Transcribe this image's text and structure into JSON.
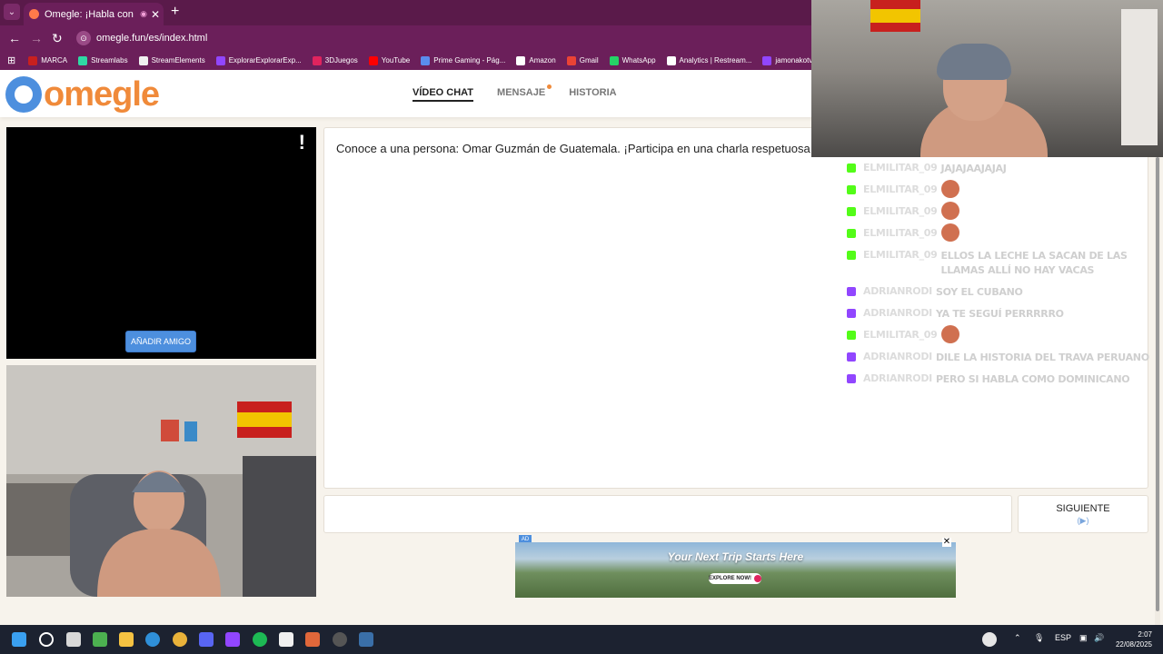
{
  "browser": {
    "tab_title": "Omegle: ¡Habla con Descon",
    "tab_audio_dot": "◉",
    "tab_close": "✕",
    "new_tab": "+",
    "url": "omegle.fun/es/index.html",
    "bookmarks": [
      {
        "label": "MARCA",
        "color": "#c8201e"
      },
      {
        "label": "Streamlabs",
        "color": "#2fd8a4"
      },
      {
        "label": "StreamElements",
        "color": "#f0f0f0"
      },
      {
        "label": "ExplorarExplorarExp...",
        "color": "#9146ff"
      },
      {
        "label": "3DJuegos",
        "color": "#e0245e"
      },
      {
        "label": "YouTube",
        "color": "#ff0000"
      },
      {
        "label": "Prime Gaming - Pág...",
        "color": "#5a8dee"
      },
      {
        "label": "Amazon",
        "color": "#ffffff"
      },
      {
        "label": "Gmail",
        "color": "#ea4335"
      },
      {
        "label": "WhatsApp",
        "color": "#25d366"
      },
      {
        "label": "Analytics | Restream...",
        "color": "#ffffff"
      },
      {
        "label": "jamonakotv - T",
        "color": "#9146ff"
      }
    ]
  },
  "site": {
    "logo": "omegle",
    "nav": [
      "VÍDEO CHAT",
      "MENSAJE",
      "HISTORIA"
    ]
  },
  "video": {
    "report": "!",
    "add_friend": "AÑADIR AMIGO"
  },
  "chat": {
    "intro": "Conoce a una persona: Omar Guzmán de Guatemala. ¡Participa en una charla respetuosa"
  },
  "next_button": {
    "label": "SIGUIENTE",
    "sub": "(▶)"
  },
  "ad": {
    "tag": "AD",
    "close": "✕",
    "headline": "Your Next Trip Starts Here",
    "cta": "EXPLORE NOW!"
  },
  "stream_chat": [
    {
      "platform": "kick",
      "user": "elmilitar_09",
      "text": "JAJAJAAJAJAJ",
      "emote": false
    },
    {
      "platform": "kick",
      "user": "elmilitar_09",
      "text": "",
      "emote": true
    },
    {
      "platform": "kick",
      "user": "elmilitar_09",
      "text": "",
      "emote": true
    },
    {
      "platform": "kick",
      "user": "elmilitar_09",
      "text": "",
      "emote": true
    },
    {
      "platform": "kick",
      "user": "elmilitar_09",
      "text": "ELLOS LA LECHE LA SACAN DE LAS LLAMAS ALLÍ NO HAY VACAS",
      "emote": false
    },
    {
      "platform": "twitch",
      "user": "adrianrodi",
      "text": "SOY EL CUBANO",
      "emote": false
    },
    {
      "platform": "twitch",
      "user": "adrianrodi",
      "text": "YA TE SEGUÍ PERRRRRO",
      "emote": false
    },
    {
      "platform": "kick",
      "user": "elmilitar_09",
      "text": "",
      "emote": true
    },
    {
      "platform": "twitch",
      "user": "adrianrodi",
      "text": "DILE LA HISTORIA DEL TRAVA PERUANO",
      "emote": false
    },
    {
      "platform": "twitch",
      "user": "adrianrodi",
      "text": "PERO SI HABLA COMO DOMINICANO",
      "emote": false
    }
  ],
  "taskbar": {
    "lang": "ESP",
    "time": "2:07",
    "date": "22/08/2025"
  }
}
